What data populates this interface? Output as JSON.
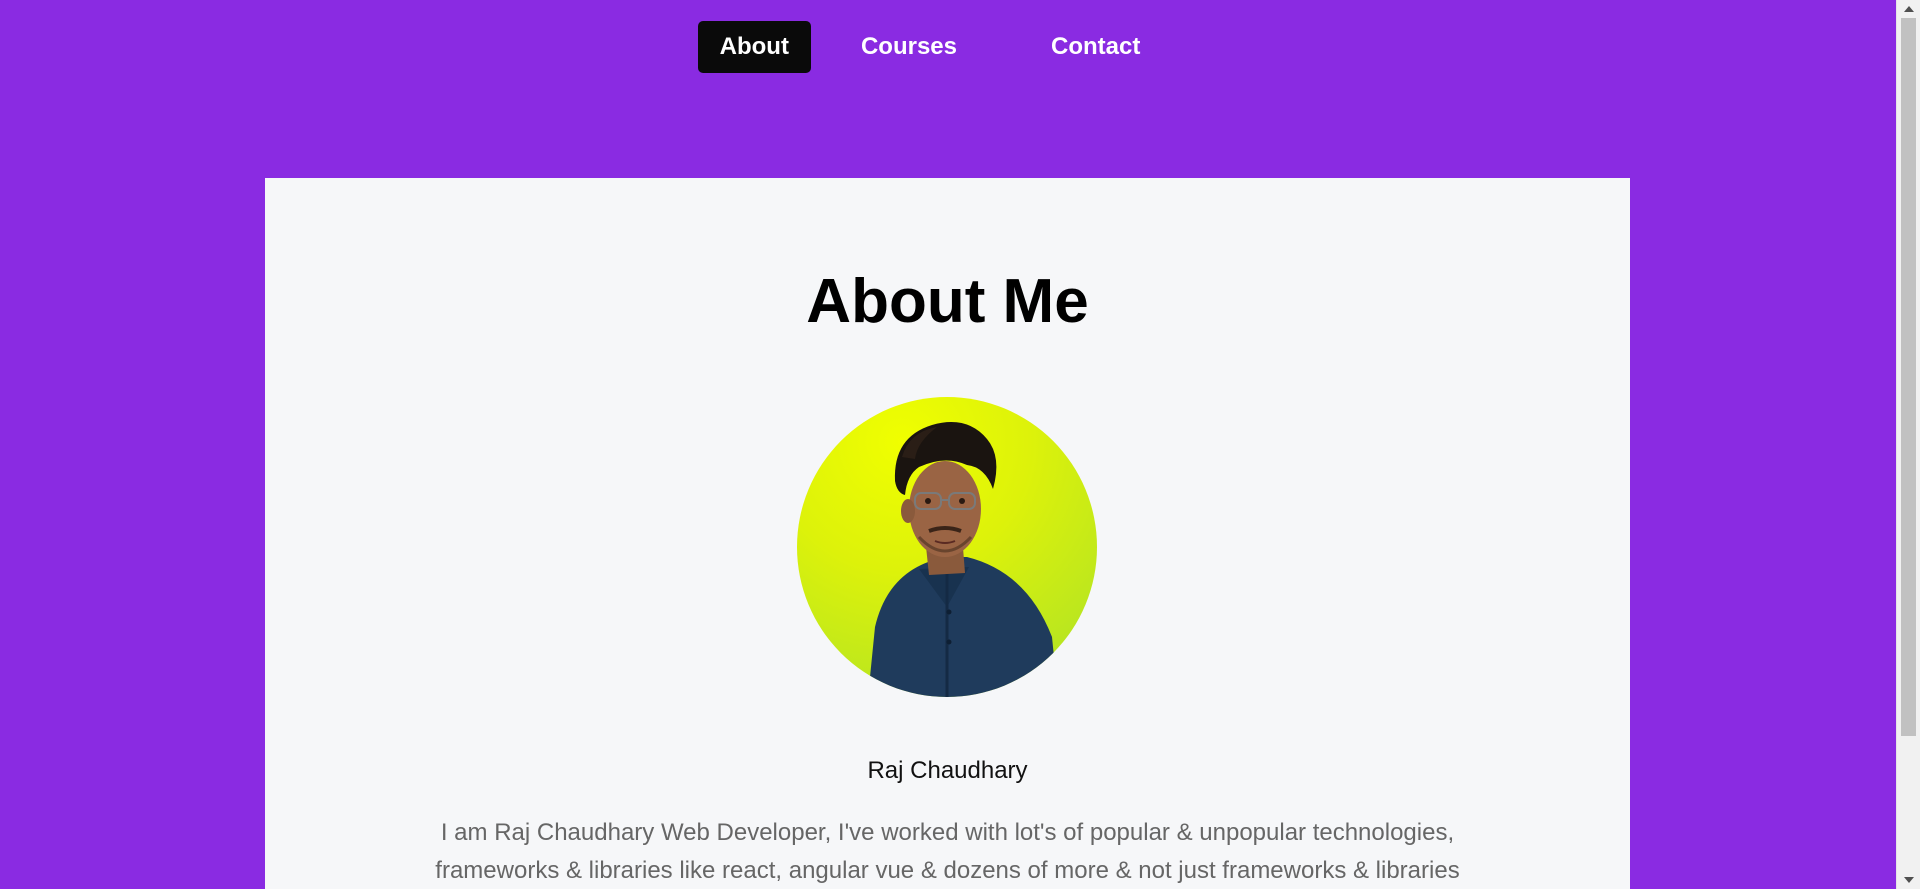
{
  "nav": {
    "items": [
      {
        "label": "About",
        "active": true
      },
      {
        "label": "Courses",
        "active": false
      },
      {
        "label": "Contact",
        "active": false
      }
    ]
  },
  "about": {
    "title": "About Me",
    "avatar_icon": "profile-photo",
    "name": "Raj Chaudhary",
    "bio_line1": "I am Raj Chaudhary Web Developer, I've worked with lot's of popular & unpopular technologies,",
    "bio_line2": "frameworks & libraries like react, angular vue & dozens of more & not just frameworks & libraries"
  },
  "colors": {
    "page_background": "#8a2be2",
    "card_background": "#f6f7f9",
    "active_nav_background": "#0a0a0a",
    "avatar_gradient_top": "#f0ff00",
    "avatar_gradient_bottom": "#a8e02a"
  }
}
